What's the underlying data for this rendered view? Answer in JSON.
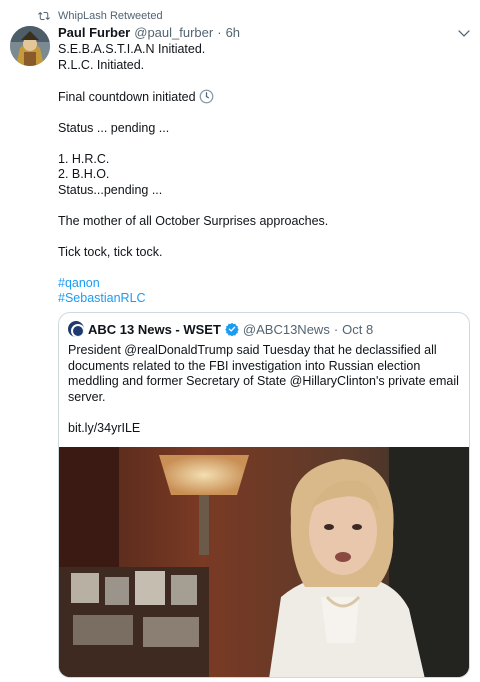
{
  "retweet": {
    "icon": "retweet-icon",
    "label": "WhipLash Retweeted"
  },
  "tweet": {
    "author_name": "Paul Furber",
    "author_handle": "@paul_furber",
    "separator": "·",
    "time": "6h",
    "lines": [
      "S.E.B.A.S.T.I.A.N Initiated.",
      "R.L.C. Initiated.",
      "",
      "Final countdown initiated",
      "",
      "Status ... pending ...",
      "",
      "1. H.R.C.",
      "2. B.H.O.",
      "Status...pending ...",
      "",
      "The mother of all October Surprises approaches.",
      "",
      "Tick tock, tick tock.",
      ""
    ],
    "hashtags": [
      "#qanon",
      "#SebastianRLC"
    ],
    "menu_icon": "chevron-down-icon",
    "emoji_icon": "clock-icon"
  },
  "quote": {
    "author_name": "ABC 13 News - WSET",
    "verified_icon": "verified-badge-icon",
    "author_handle": "@ABC13News",
    "separator": "·",
    "time": "Oct 8",
    "text": "President @realDonaldTrump said Tuesday that he declassified all documents related to the FBI investigation into Russian election meddling and former Secretary of State @HillaryClinton's private email server.",
    "link": "bit.ly/34yrILE"
  },
  "colors": {
    "link": "#1d9bf0",
    "muted": "#536471",
    "border": "#cfd9de",
    "verified": "#1d9bf0"
  }
}
